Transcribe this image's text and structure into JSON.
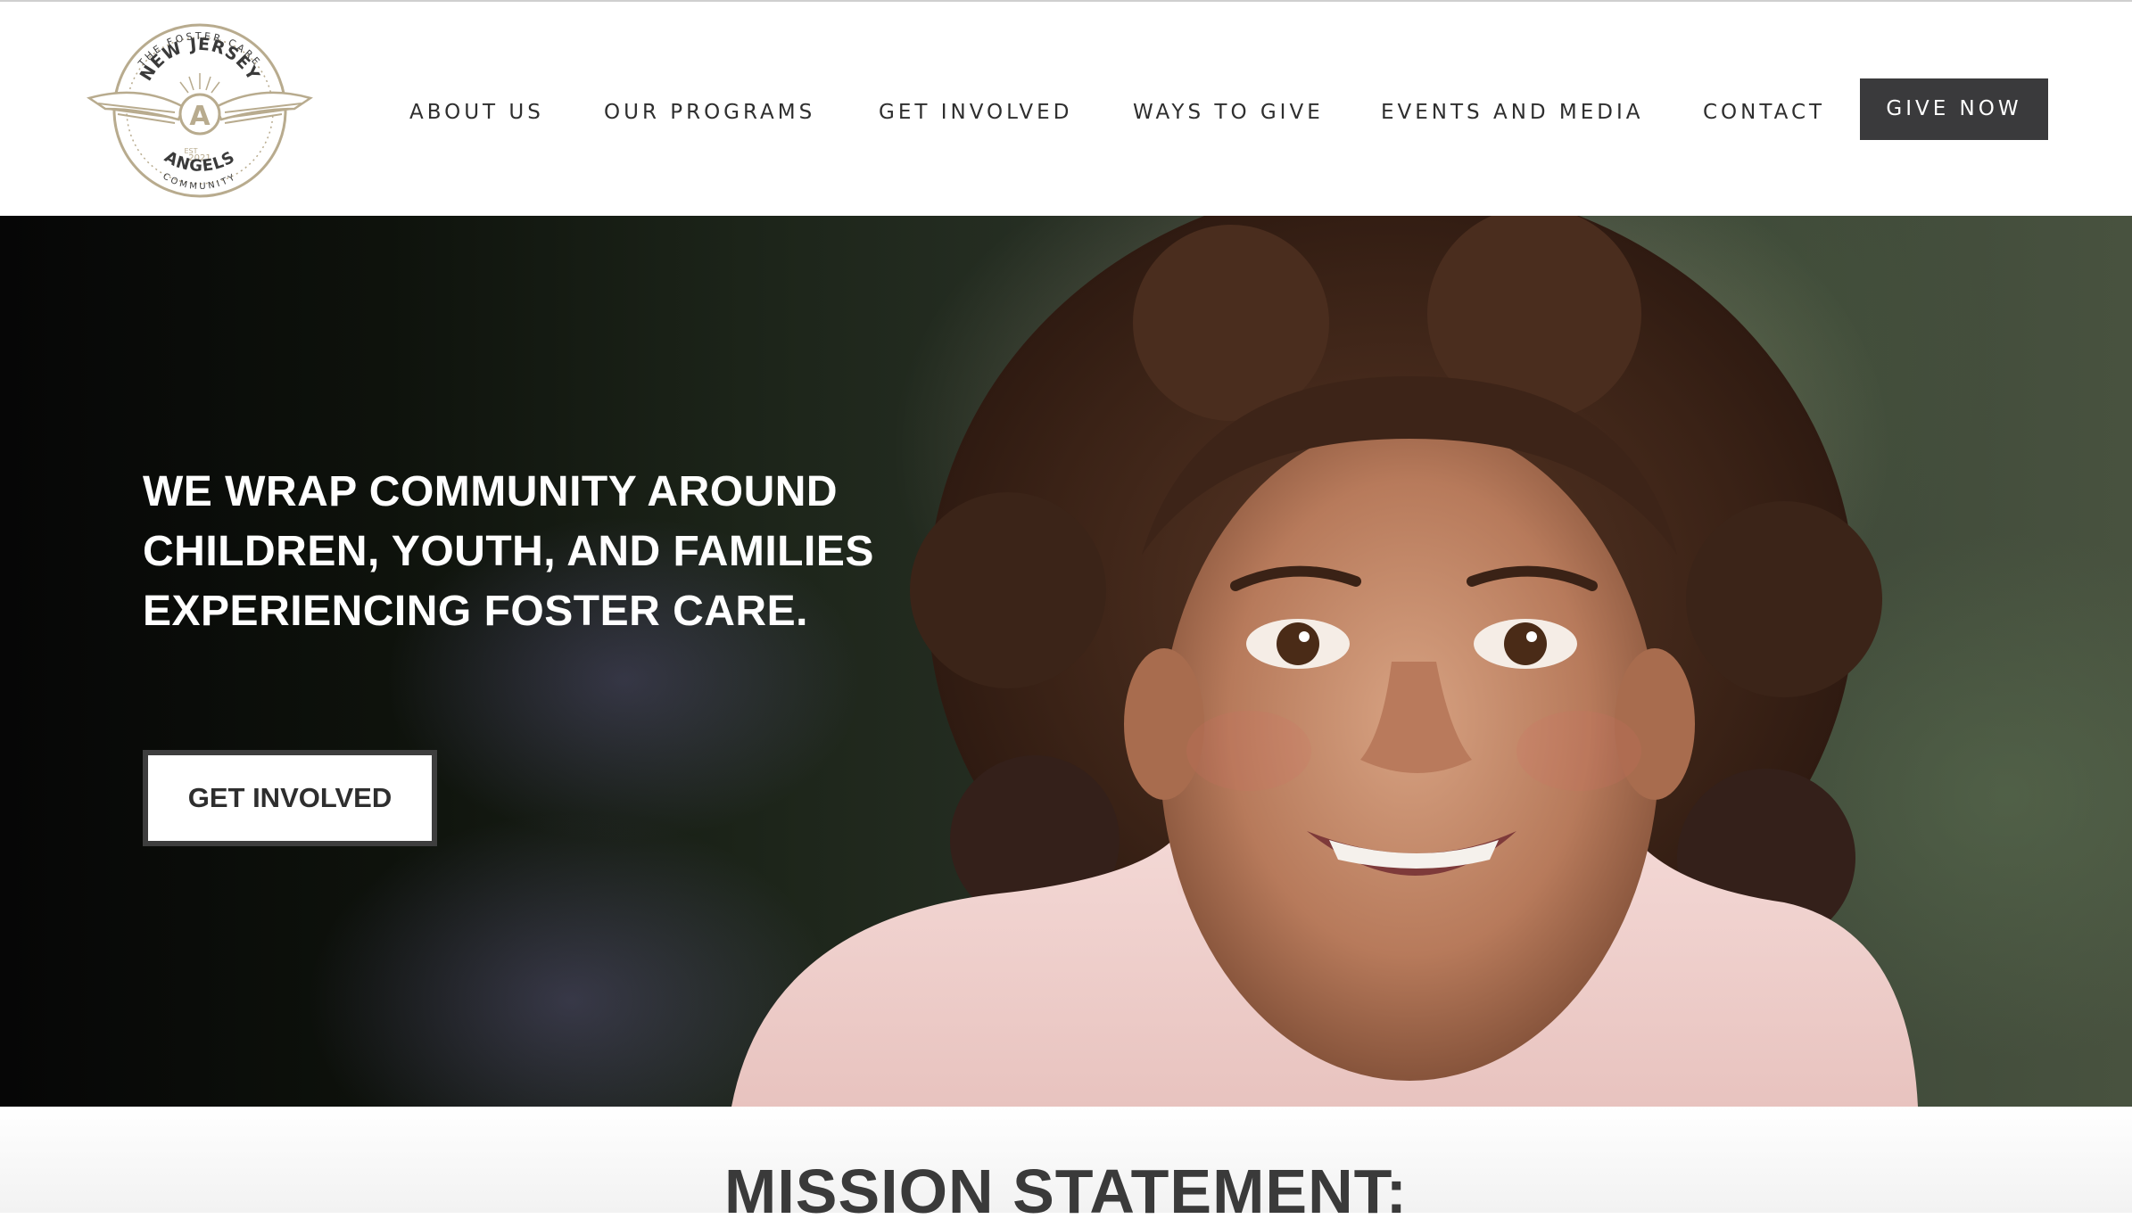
{
  "logo": {
    "arc_top": "THE FOSTER CARE",
    "state": "NEW JERSEY",
    "monogram": "A",
    "est": "EST",
    "year": "2021",
    "org": "ANGELS",
    "arc_bottom": "COMMUNITY",
    "color": "#b8ab8e"
  },
  "nav": {
    "items": [
      "ABOUT US",
      "OUR PROGRAMS",
      "GET INVOLVED",
      "WAYS TO GIVE",
      "EVENTS AND MEDIA",
      "CONTACT"
    ],
    "cta": "GIVE NOW"
  },
  "hero": {
    "headline": "WE WRAP COMMUNITY AROUND CHILDREN, YOUTH, AND FAMILIES EXPERIENCING FOSTER CARE.",
    "button": "GET INVOLVED"
  },
  "mission": {
    "title_bold": "MISSION",
    "title_rest": "STATEMENT:"
  },
  "colors": {
    "text": "#2e2e2e",
    "button_dark": "#3a3a3c",
    "logo_gold": "#b8ab8e"
  }
}
